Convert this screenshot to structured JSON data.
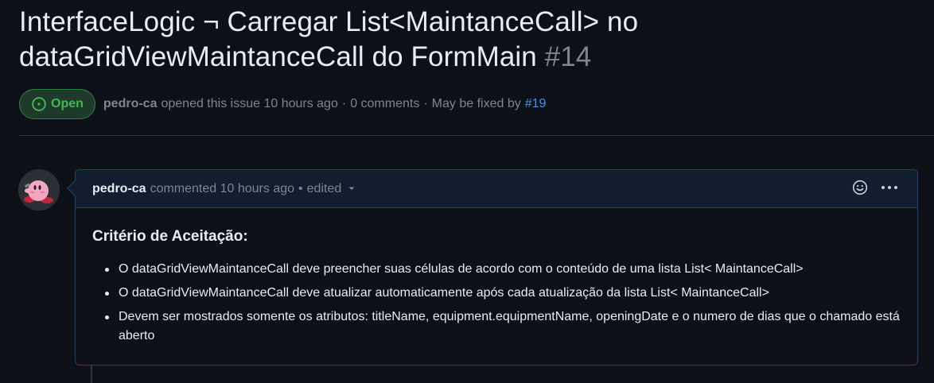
{
  "issue": {
    "title": "InterfaceLogic ¬ Carregar List<MaintanceCall> no dataGridViewMaintanceCall do FormMain",
    "number": "#14",
    "state_label": "Open",
    "author": "pedro-ca",
    "opened_text": "opened this issue 10 hours ago",
    "dot1": "·",
    "comments_text": "0 comments",
    "dot2": "·",
    "fixed_by_text": "May be fixed by",
    "fixed_by_link": "#19"
  },
  "comment": {
    "author": "pedro-ca",
    "commented_text": "commented 10 hours ago",
    "bullet": "•",
    "edited_text": "edited",
    "heading": "Critério de Aceitação:",
    "items": [
      "O dataGridViewMaintanceCall deve preencher suas células de acordo com o conteúdo de uma lista List< MaintanceCall>",
      "O dataGridViewMaintanceCall deve atualizar automaticamente após cada atualização da lista List< MaintanceCall>",
      "Devem ser mostrados somente os atributos: titleName, equipment.equipmentName, openingDate e o numero de dias que o chamado está aberto"
    ]
  },
  "icons": {
    "state": "issue-opened-icon",
    "edited_caret": "triangle-down-icon",
    "reaction": "smiley-icon",
    "menu": "kebab-horizontal-icon",
    "avatar": "kirby-avatar"
  },
  "colors": {
    "background": "#0d1117",
    "open_green": "#3fb950",
    "link_blue": "#4493f8",
    "comment_border": "#1f4273",
    "comment_header_bg": "#121d2f"
  }
}
